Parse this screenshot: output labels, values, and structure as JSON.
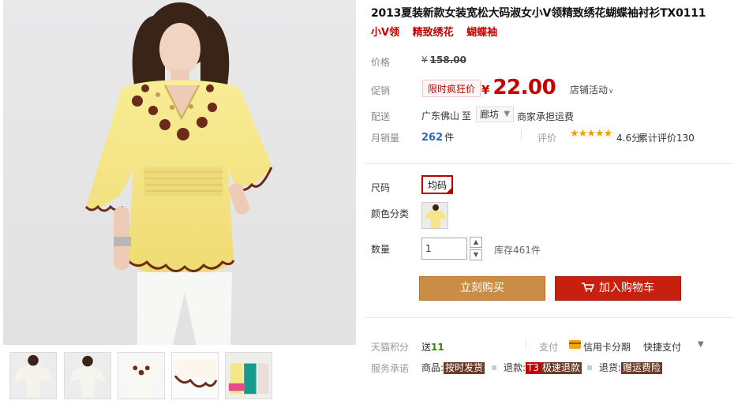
{
  "product": {
    "title": "2013夏装新款女装宽松大码淑女小V领精致绣花蝴蝶袖衬衫TX0111",
    "tags": [
      "小V领",
      "精致绣花",
      "蝴蝶袖"
    ]
  },
  "price": {
    "label": "价格",
    "currency": "¥",
    "original": "158.00"
  },
  "promo": {
    "label": "促销",
    "badge": "限时疯狂价",
    "currency": "¥",
    "price": "22.00",
    "store_activity": "店铺活动"
  },
  "shipping": {
    "label": "配送",
    "from": "广东佛山",
    "to_word": "至",
    "city": "廊坊",
    "fee_note": "商家承担运费"
  },
  "sales": {
    "label": "月销量",
    "count": "262",
    "unit": "件"
  },
  "rating": {
    "label": "评价",
    "stars": "★★★★★",
    "score_text": "4.6分",
    "reviews_text": "累计评价130",
    "score": 4.6
  },
  "size": {
    "label": "尺码",
    "selected": "均码"
  },
  "color": {
    "label": "颜色分类"
  },
  "quantity": {
    "label": "数量",
    "value": "1",
    "stock": "库存461件"
  },
  "buttons": {
    "buy_now": "立刻购买",
    "add_to_cart": "加入购物车"
  },
  "points": {
    "label": "天猫积分",
    "prefix": "送",
    "value": "11"
  },
  "payment": {
    "label": "支付",
    "credit": "信用卡分期",
    "quick": "快捷支付"
  },
  "service": {
    "label": "服务承诺",
    "items": [
      {
        "prefix": "商品:",
        "tag": "按时发货"
      },
      {
        "prefix": "退款:",
        "tag": "极速退款",
        "badge": "T3"
      },
      {
        "prefix": "退货:",
        "tag": "赠运费险"
      }
    ]
  },
  "colors": {
    "accent_red": "#c40000",
    "buy_button": "#c98d45",
    "cart_button": "#c8200f",
    "blouse_yellow": "#f6e68a",
    "embroidery_brown": "#6b2a1a"
  },
  "icons": [
    "chevron-down-icon",
    "star-icon",
    "cart-icon",
    "credit-card-icon",
    "triangle-down-icon",
    "selected-tick-icon"
  ]
}
